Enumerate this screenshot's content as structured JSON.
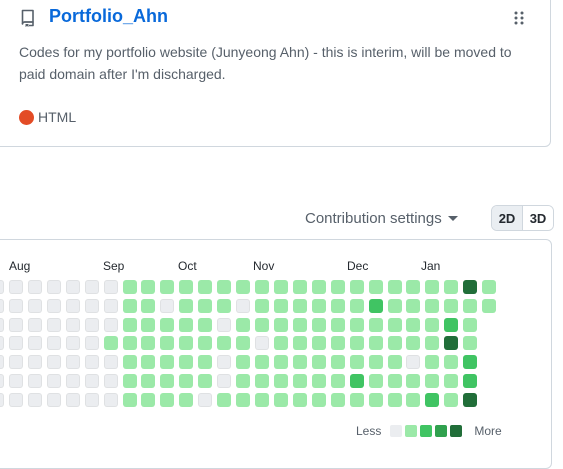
{
  "repo": {
    "name": "Portfolio_Ahn",
    "description": "Codes for my portfolio website (Junyeong Ahn) - this is interim, will be moved to paid domain after I'm discharged.",
    "language": "HTML",
    "language_color": "#e34c26"
  },
  "contributions": {
    "settings_label": "Contribution settings",
    "view_2d": "2D",
    "view_3d": "3D",
    "months": [
      "Aug",
      "Sep",
      "Oct",
      "Nov",
      "Dec",
      "Jan"
    ],
    "legend_less": "Less",
    "legend_more": "More",
    "level_colors": [
      "#ebedf0",
      "#9be9a8",
      "#40c463",
      "#30a14e",
      "#216e39"
    ],
    "weeks": [
      [
        0,
        0,
        0,
        0,
        0,
        0,
        0
      ],
      [
        0,
        0,
        0,
        0,
        0,
        0,
        0
      ],
      [
        0,
        0,
        0,
        0,
        0,
        0,
        0
      ],
      [
        0,
        0,
        0,
        0,
        0,
        0,
        0
      ],
      [
        0,
        0,
        0,
        0,
        0,
        0,
        0
      ],
      [
        0,
        0,
        0,
        0,
        0,
        0,
        0
      ],
      [
        0,
        0,
        0,
        1,
        0,
        0,
        0
      ],
      [
        1,
        1,
        1,
        1,
        1,
        1,
        1
      ],
      [
        1,
        1,
        1,
        1,
        1,
        1,
        1
      ],
      [
        1,
        0,
        1,
        1,
        1,
        1,
        1
      ],
      [
        1,
        1,
        1,
        1,
        1,
        1,
        1
      ],
      [
        1,
        1,
        1,
        1,
        1,
        1,
        0
      ],
      [
        1,
        1,
        0,
        1,
        0,
        0,
        1
      ],
      [
        1,
        0,
        1,
        1,
        1,
        1,
        1
      ],
      [
        1,
        1,
        1,
        0,
        1,
        1,
        1
      ],
      [
        1,
        1,
        1,
        1,
        1,
        1,
        1
      ],
      [
        1,
        1,
        1,
        1,
        1,
        1,
        1
      ],
      [
        1,
        1,
        1,
        1,
        1,
        1,
        1
      ],
      [
        1,
        1,
        1,
        1,
        1,
        1,
        1
      ],
      [
        1,
        1,
        1,
        1,
        1,
        2,
        1
      ],
      [
        1,
        2,
        1,
        1,
        1,
        1,
        1
      ],
      [
        1,
        1,
        1,
        1,
        1,
        1,
        1
      ],
      [
        1,
        1,
        1,
        1,
        0,
        1,
        1
      ],
      [
        1,
        1,
        1,
        1,
        1,
        1,
        2
      ],
      [
        1,
        1,
        2,
        4,
        1,
        1,
        1
      ],
      [
        4,
        1,
        1,
        1,
        2,
        2,
        4
      ],
      [
        1,
        1
      ]
    ]
  }
}
